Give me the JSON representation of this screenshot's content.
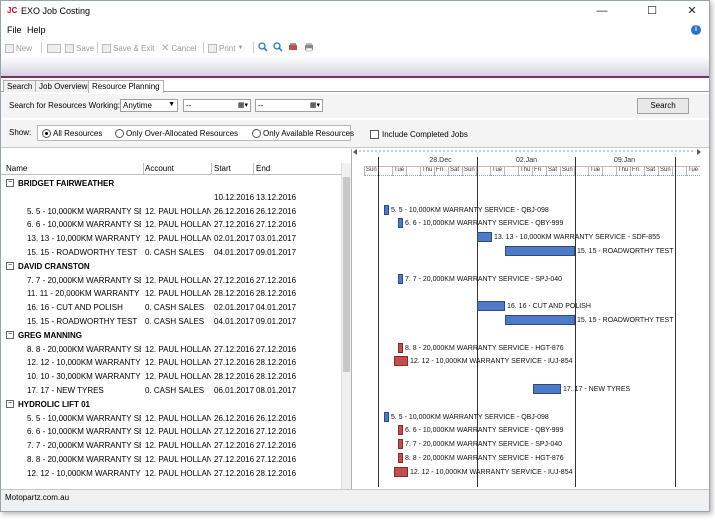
{
  "window": {
    "logo": "JC",
    "title": "EXO Job Costing",
    "minimize": "—",
    "maximize": "☐",
    "close": "✕"
  },
  "menu": {
    "file": "File",
    "help": "Help",
    "help_icon": "i"
  },
  "toolbar": {
    "new": "New",
    "save": "Save",
    "save_exit": "Save & Exit",
    "cancel": "Cancel",
    "print": "Print"
  },
  "tabs": [
    "Search",
    "Job Overview",
    "Resource Planning"
  ],
  "filter": {
    "label": "Search for Resources Working:",
    "period": "Anytime",
    "from": "--",
    "to": "--",
    "search_button": "Search"
  },
  "show": {
    "label": "Show:",
    "all": "All Resources",
    "over": "Only Over-Allocated Resources",
    "available": "Only Available Resources",
    "include_completed": "Include Completed Jobs"
  },
  "columns": {
    "name": "Name",
    "account": "Account",
    "start": "Start",
    "end": "End"
  },
  "rows": [
    {
      "type": "group",
      "name": "BRIDGET FAIRWEATHER"
    },
    {
      "type": "item",
      "name": "",
      "account": "",
      "start": "10.12.2016",
      "end": "13.12.2016"
    },
    {
      "type": "item",
      "name": "5. 5 - 10,000KM WARRANTY SERV",
      "account": "12. PAUL HOLLAND",
      "start": "26.12.2016",
      "end": "26.12.2016"
    },
    {
      "type": "item",
      "name": "6. 6 - 10,000KM WARRANTY SERV",
      "account": "12. PAUL HOLLAND",
      "start": "27.12.2016",
      "end": "27.12.2016"
    },
    {
      "type": "item",
      "name": "13. 13 - 10,000KM WARRANTY SE",
      "account": "12. PAUL HOLLAND",
      "start": "02.01.2017",
      "end": "03.01.2017"
    },
    {
      "type": "item",
      "name": "15. 15 - ROADWORTHY TEST",
      "account": "0. CASH SALES",
      "start": "04.01.2017",
      "end": "09.01.2017"
    },
    {
      "type": "group",
      "name": "DAVID CRANSTON"
    },
    {
      "type": "item",
      "name": "7. 7 - 20,000KM WARRANTY SERV",
      "account": "12. PAUL HOLLAND",
      "start": "27.12.2016",
      "end": "27.12.2016"
    },
    {
      "type": "item",
      "name": "11. 11 - 20,000KM WARRANTY SE",
      "account": "12. PAUL HOLLAND",
      "start": "28.12.2016",
      "end": "28.12.2016"
    },
    {
      "type": "item",
      "name": "16. 16 - CUT AND POLISH",
      "account": "0. CASH SALES",
      "start": "02.01.2017",
      "end": "04.01.2017"
    },
    {
      "type": "item",
      "name": "15. 15 - ROADWORTHY TEST",
      "account": "0. CASH SALES",
      "start": "04.01.2017",
      "end": "09.01.2017"
    },
    {
      "type": "group",
      "name": "GREG MANNING"
    },
    {
      "type": "item",
      "name": "8. 8 - 20,000KM WARRANTY SERV",
      "account": "12. PAUL HOLLAND",
      "start": "27.12.2016",
      "end": "27.12.2016"
    },
    {
      "type": "item",
      "name": "12. 12 - 10,000KM WARRANTY SE",
      "account": "12. PAUL HOLLAND",
      "start": "27.12.2016",
      "end": "28.12.2016"
    },
    {
      "type": "item",
      "name": "10. 10 - 30,000KM WARRANTY SE",
      "account": "12. PAUL HOLLAND",
      "start": "28.12.2016",
      "end": "28.12.2016"
    },
    {
      "type": "item",
      "name": "17. 17 - NEW TYRES",
      "account": "0. CASH SALES",
      "start": "06.01.2017",
      "end": "08.01.2017"
    },
    {
      "type": "group",
      "name": "HYDROLIC LIFT 01"
    },
    {
      "type": "item",
      "name": "5. 5 - 10,000KM WARRANTY SERV",
      "account": "12. PAUL HOLLAND",
      "start": "26.12.2016",
      "end": "26.12.2016"
    },
    {
      "type": "item",
      "name": "6. 6 - 10,000KM WARRANTY SERV",
      "account": "12. PAUL HOLLAND",
      "start": "27.12.2016",
      "end": "27.12.2016"
    },
    {
      "type": "item",
      "name": "7. 7 - 20,000KM WARRANTY SERV",
      "account": "12. PAUL HOLLAND",
      "start": "27.12.2016",
      "end": "27.12.2016"
    },
    {
      "type": "item",
      "name": "8. 8 - 20,000KM WARRANTY SERV",
      "account": "12. PAUL HOLLAND",
      "start": "27.12.2016",
      "end": "27.12.2016"
    },
    {
      "type": "item",
      "name": "12. 12 - 10,000KM WARRANTY SE",
      "account": "12. PAUL HOLLAND",
      "start": "27.12.2016",
      "end": "28.12.2016"
    }
  ],
  "gantt": {
    "weeks": [
      "28.Dec",
      "02.Jan",
      "09.Jan"
    ],
    "days": [
      "Sun",
      "",
      "Tue",
      "",
      "Thu",
      "Fri",
      "Sat",
      "Sun",
      "",
      "Tue",
      "",
      "Thu",
      "Fri",
      "Sat",
      "Sun",
      "",
      "Tue",
      "",
      "Thu",
      "Fri",
      "Sat",
      "Sun",
      "",
      "Tue"
    ],
    "bars": [
      {
        "row": 2,
        "color": "blue",
        "label": "5. 5 - 10,000KM WARRANTY SERVICE - QBJ-098"
      },
      {
        "row": 3,
        "color": "blue",
        "label": "6. 6 - 10,000KM WARRANTY SERVICE - QBY-999"
      },
      {
        "row": 4,
        "color": "blue",
        "label": "13. 13 - 10,000KM WARRANTY SERVICE - SDF-855"
      },
      {
        "row": 5,
        "color": "blue",
        "label": "15. 15 - ROADWORTHY TEST"
      },
      {
        "row": 7,
        "color": "blue",
        "label": "7. 7 - 20,000KM WARRANTY SERVICE - SPJ-040"
      },
      {
        "row": 9,
        "color": "blue",
        "label": "16. 16 - CUT AND POLISH"
      },
      {
        "row": 10,
        "color": "blue",
        "label": "15. 15 - ROADWORTHY TEST"
      },
      {
        "row": 12,
        "color": "red",
        "label": "8. 8 - 20,000KM WARRANTY SERVICE - HGT-876"
      },
      {
        "row": 13,
        "color": "red",
        "label": "12. 12 - 10,000KM WARRANTY SERVICE - IUJ-854"
      },
      {
        "row": 15,
        "color": "blue",
        "label": "17. 17 - NEW TYRES"
      },
      {
        "row": 17,
        "color": "blue",
        "label": "5. 5 - 10,000KM WARRANTY SERVICE - QBJ-098"
      },
      {
        "row": 18,
        "color": "red",
        "label": "6. 6 - 10,000KM WARRANTY SERVICE - QBY-999"
      },
      {
        "row": 19,
        "color": "red",
        "label": "7. 7 - 20,000KM WARRANTY SERVICE - SPJ-040"
      },
      {
        "row": 20,
        "color": "red",
        "label": "8. 8 - 20,000KM WARRANTY SERVICE - HGT-876"
      },
      {
        "row": 21,
        "color": "red",
        "label": "12. 12 - 10,000KM WARRANTY SERVICE - IUJ-854"
      }
    ]
  },
  "status": {
    "text": "Motopartz.com.au"
  },
  "colors": {
    "accent": "#7b2d6e",
    "bar_blue": "#4f7ac8",
    "bar_red": "#c0504d"
  }
}
